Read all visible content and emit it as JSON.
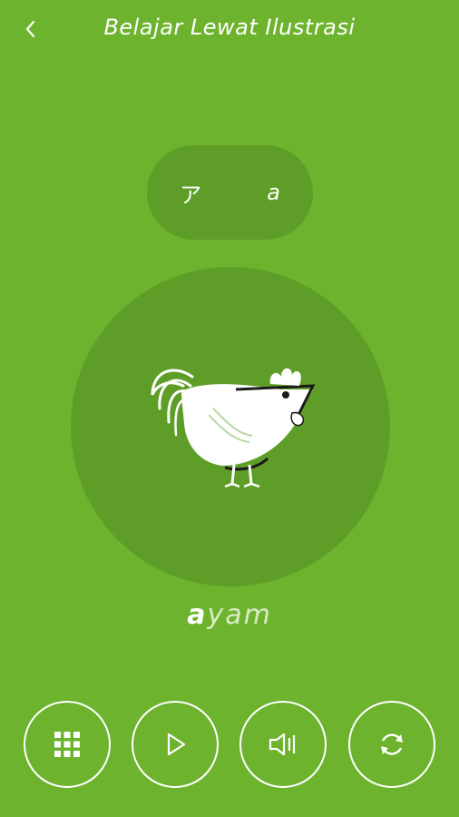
{
  "header": {
    "title": "Belajar Lewat Ilustrasi",
    "back_icon": "chevron-left-icon"
  },
  "character": {
    "kana": "ア",
    "romaji": "a"
  },
  "illustration": {
    "subject": "rooster-illustration"
  },
  "word": {
    "highlight": "a",
    "rest": "yam"
  },
  "controls": [
    {
      "icon": "grid-icon"
    },
    {
      "icon": "play-icon"
    },
    {
      "icon": "speaker-icon"
    },
    {
      "icon": "refresh-icon"
    }
  ],
  "colors": {
    "background": "#6db32e",
    "panel": "#5e9e28",
    "foreground": "#ffffff"
  }
}
